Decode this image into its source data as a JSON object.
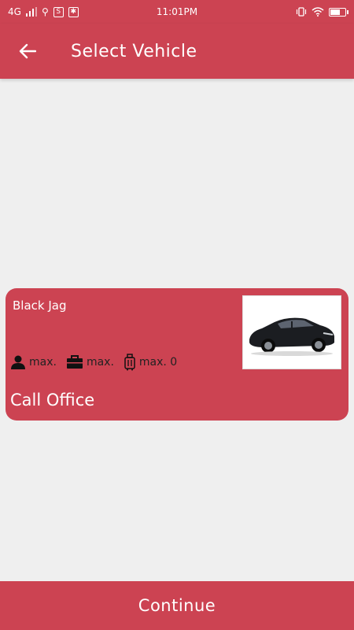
{
  "status_bar": {
    "network": "4G",
    "time": "11:01PM"
  },
  "app_bar": {
    "title": "Select Vehicle"
  },
  "vehicle": {
    "name": "Black Jag",
    "capacities": [
      {
        "icon": "person-icon",
        "label": "max."
      },
      {
        "icon": "briefcase-icon",
        "label": "max."
      },
      {
        "icon": "luggage-icon",
        "label": "max. 0"
      }
    ],
    "price_text": "Call Office"
  },
  "continue_button": {
    "label": "Continue"
  },
  "colors": {
    "accent": "#cc4352",
    "background": "#efefef"
  }
}
